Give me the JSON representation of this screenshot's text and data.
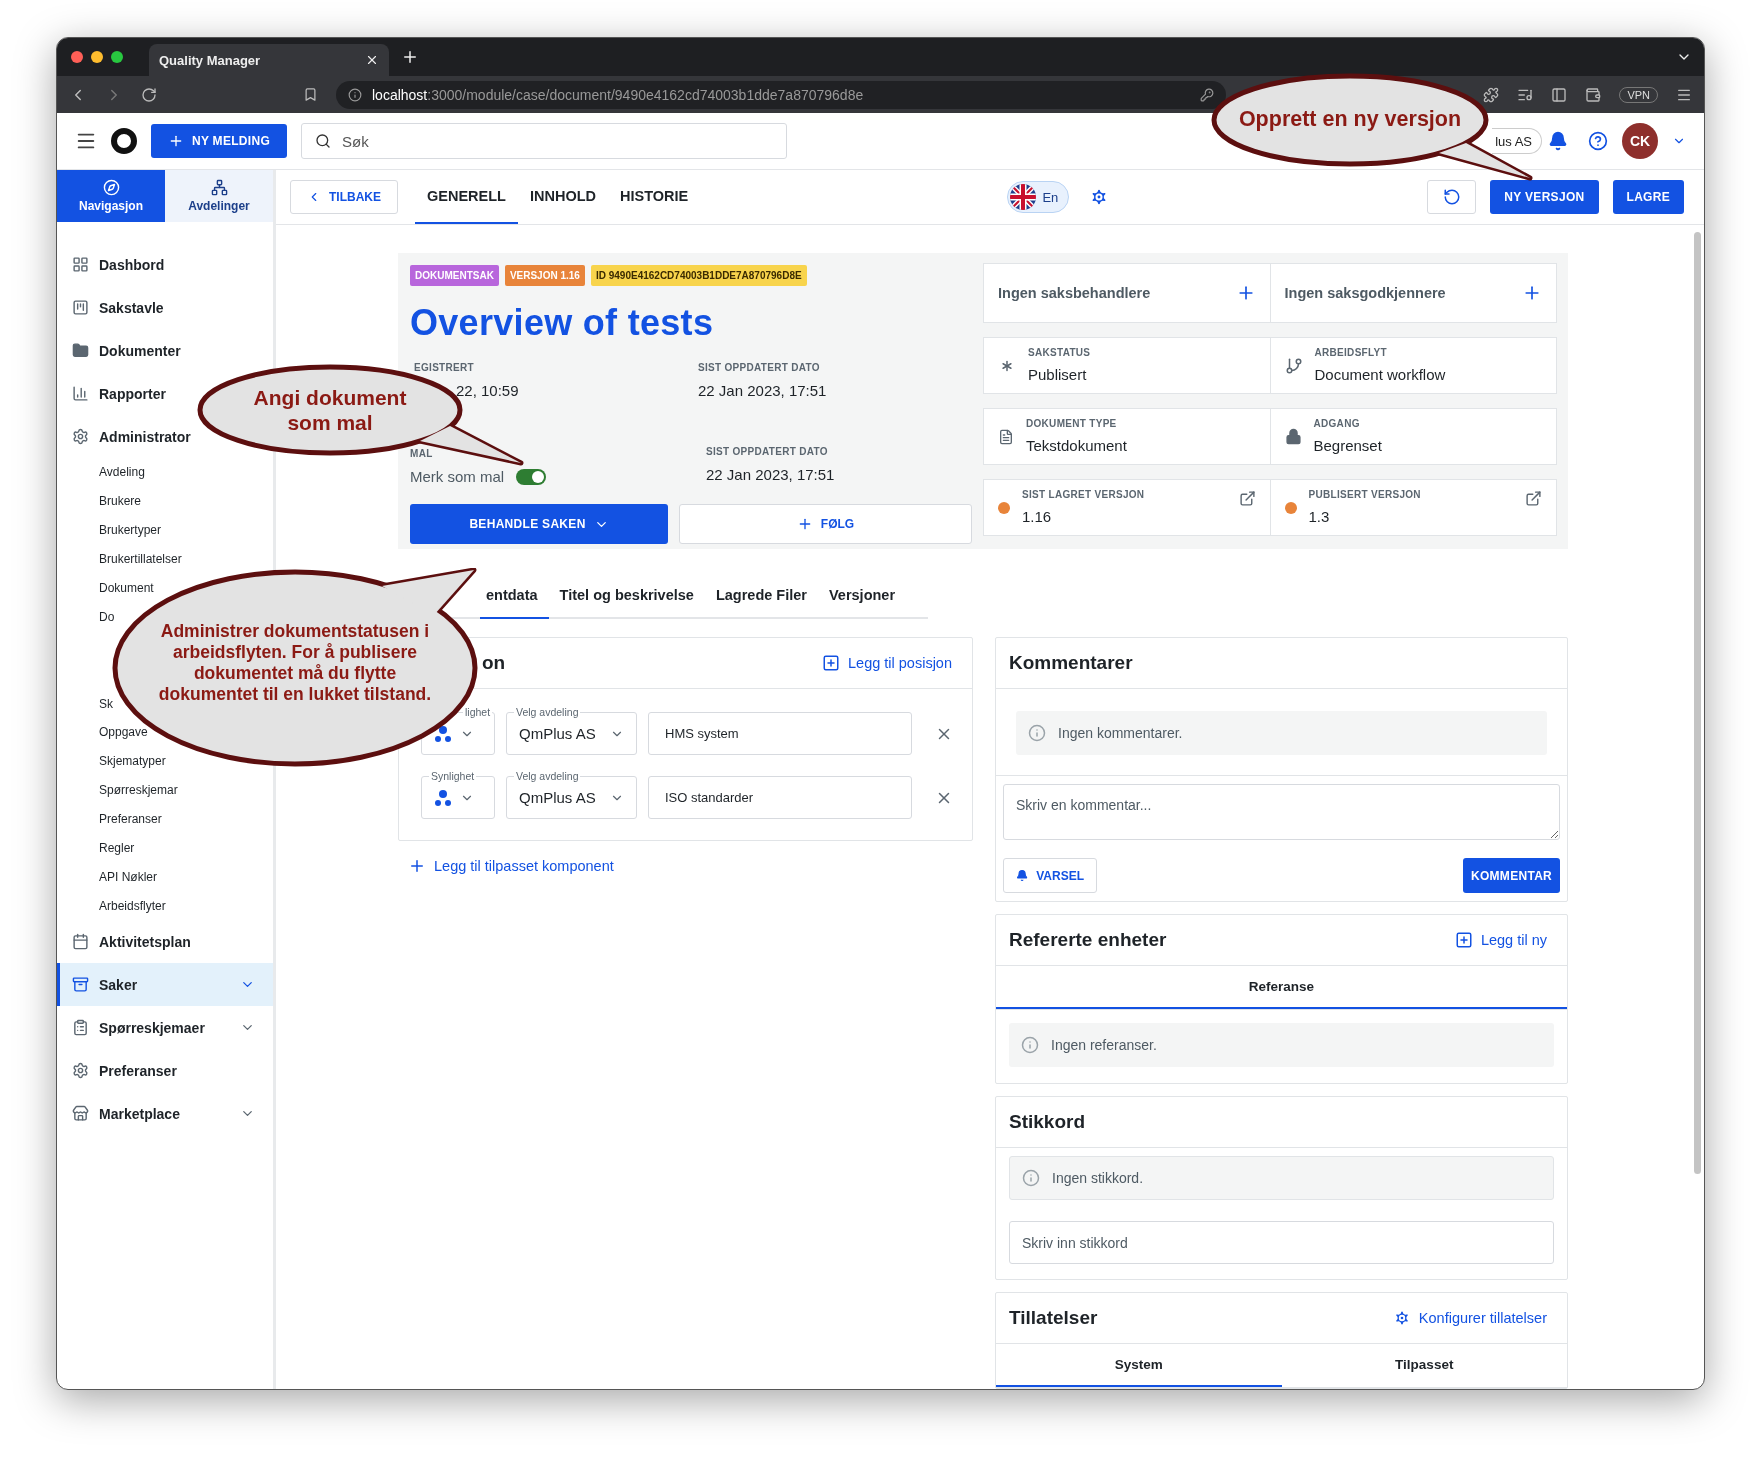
{
  "browser": {
    "tab_title": "Quality Manager",
    "url_host": "localhost",
    "url_path": ":3000/module/case/document/9490e4162cd74003b1dde7a870796d8e",
    "vpn": "VPN"
  },
  "topbar": {
    "new_button": "NY MELDING",
    "search_placeholder": "Søk",
    "org": "lus AS",
    "avatar": "CK"
  },
  "sidebar": {
    "switch": [
      {
        "label": "Navigasjon",
        "selected": true
      },
      {
        "label": "Avdelinger",
        "selected": false
      }
    ],
    "items": [
      {
        "label": "Dashbord",
        "kind": "link",
        "selected": false
      },
      {
        "label": "Sakstavle",
        "kind": "link",
        "selected": false
      },
      {
        "label": "Dokumenter",
        "kind": "link",
        "selected": false
      },
      {
        "label": "Rapporter",
        "kind": "link",
        "selected": false
      },
      {
        "label": "Administrator",
        "kind": "group",
        "expanded": true,
        "selected": false,
        "children": [
          "Avdeling",
          "Brukere",
          "Brukertyper",
          "Brukertillatelser",
          "Dokument",
          "Do",
          "Sk",
          "Oppgave",
          "Skjematyper",
          "Spørreskjemar",
          "Preferanser",
          "Regler",
          "API Nøkler",
          "Arbeidsflyter"
        ]
      },
      {
        "label": "Aktivitetsplan",
        "kind": "link",
        "selected": false
      },
      {
        "label": "Saker",
        "kind": "group",
        "expanded": false,
        "selected": true
      },
      {
        "label": "Spørreskjemaer",
        "kind": "group",
        "expanded": false,
        "selected": false
      },
      {
        "label": "Preferanser",
        "kind": "link",
        "selected": false
      },
      {
        "label": "Marketplace",
        "kind": "group",
        "expanded": false,
        "selected": false
      }
    ]
  },
  "header": {
    "back": "TILBAKE",
    "tabs": [
      {
        "label": "GENERELL",
        "selected": true
      },
      {
        "label": "INNHOLD",
        "selected": false
      },
      {
        "label": "HISTORIE",
        "selected": false
      }
    ],
    "language": {
      "label": "En",
      "selected": true
    },
    "buttons": [
      "NY VERSJON",
      "LAGRE"
    ]
  },
  "summary": {
    "tags": [
      {
        "label": "DOKUMENTSAK",
        "color": "#b866dc"
      },
      {
        "label": "VERSJON 1.16",
        "color": "#e8843a"
      },
      {
        "label": "ID 9490E4162CD74003B1DDE7A870796D8E",
        "color": "#f8d44c"
      }
    ],
    "title": "Overview of tests",
    "fields": [
      {
        "label": "EGISTRERT",
        "value": "22, 10:59"
      },
      {
        "label": "SIST OPPDATERT DATO",
        "value": "22 Jan 2023, 17:51"
      }
    ],
    "template": {
      "label": "MAL",
      "text": "Merk som mal",
      "on": true
    },
    "updated": {
      "label": "SIST OPPDATERT DATO",
      "value": "22 Jan 2023, 17:51"
    },
    "process_button": "BEHANDLE SAKEN",
    "follow_button": "FØLG",
    "assignees": [
      "Ingen saksbehandlere",
      "Ingen saksgodkjennere"
    ],
    "info": [
      {
        "label": "SAKSTATUS",
        "value": "Publisert",
        "kind": "status"
      },
      {
        "label": "ARBEIDSFLYT",
        "value": "Document workflow",
        "kind": "workflow"
      },
      {
        "label": "DOKUMENT TYPE",
        "value": "Tekstdokument",
        "kind": "doctype"
      },
      {
        "label": "ADGANG",
        "value": "Begrenset",
        "kind": "access"
      },
      {
        "label": "SIST LAGRET VERSJON",
        "value": "1.16",
        "kind": "version"
      },
      {
        "label": "PUBLISERT VERSJON",
        "value": "1.3",
        "kind": "version"
      }
    ]
  },
  "subtabs": [
    {
      "label": "entdata",
      "selected": true
    },
    {
      "label": "Titel og beskrivelse",
      "selected": false
    },
    {
      "label": "Lagrede Filer",
      "selected": false
    },
    {
      "label": "Versjoner",
      "selected": false
    }
  ],
  "positions": {
    "title": "on",
    "action": "Legg til posisjon",
    "rows": [
      {
        "visibility_label": "lighet",
        "department_label": "Velg avdeling",
        "department": "QmPlus AS",
        "value": "HMS system"
      },
      {
        "visibility_label": "Synlighet",
        "department_label": "Velg avdeling",
        "department": "QmPlus AS",
        "value": "ISO standarder"
      }
    ],
    "add": "Legg til tilpasset komponent"
  },
  "comments": {
    "title": "Kommentarer",
    "empty": "Ingen kommentarer.",
    "placeholder": "Skriv en kommentar...",
    "notify": "VARSEL",
    "submit": "KOMMENTAR"
  },
  "references": {
    "title": "Refererte enheter",
    "action": "Legg til ny",
    "tabs": [
      {
        "label": "Referanse",
        "selected": true
      }
    ],
    "empty": "Ingen referanser."
  },
  "keywords": {
    "title": "Stikkord",
    "empty": "Ingen stikkord.",
    "placeholder": "Skriv inn stikkord"
  },
  "permissions": {
    "title": "Tillatelser",
    "action": "Konfigurer tillatelser",
    "tabs": [
      {
        "label": "System",
        "selected": true
      },
      {
        "label": "Tilpasset",
        "selected": false
      }
    ]
  },
  "callouts": [
    {
      "text": "Opprett en ny versjon"
    },
    {
      "text": "Angi dokument som mal"
    },
    {
      "text": "Administrer dokumentstatusen i arbeidsflyten. For å publisere dokumentet må du flytte dokumentet til en lukket tilstand."
    }
  ]
}
